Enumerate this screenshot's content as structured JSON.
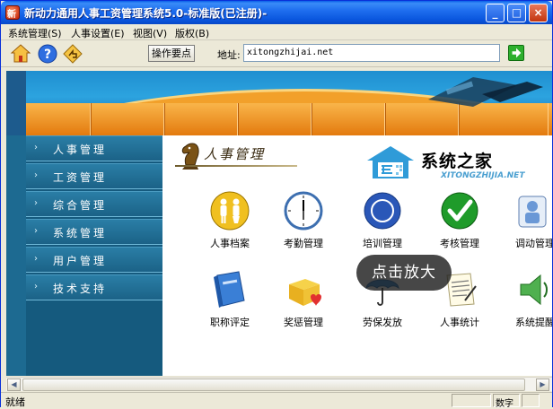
{
  "window": {
    "title": "新动力通用人事工资管理系统5.0-标准版(已注册)-",
    "controls": {
      "minimize": "_",
      "maximize": "□",
      "close": "×"
    }
  },
  "menu": [
    {
      "label": "系统管理(S)"
    },
    {
      "label": "人事设置(E)"
    },
    {
      "label": "视图(V)"
    },
    {
      "label": "版权(B)"
    }
  ],
  "toolbar": {
    "icons": [
      "home-icon",
      "help-icon",
      "back-icon"
    ],
    "guide_button": "操作要点",
    "address_label": "地址:",
    "address_value": "xitongzhijai.net",
    "go_icon": "arrow-right-icon"
  },
  "sidenav": {
    "items": [
      {
        "label": "人事管理"
      },
      {
        "label": "工资管理"
      },
      {
        "label": "综合管理"
      },
      {
        "label": "系统管理"
      },
      {
        "label": "用户管理"
      },
      {
        "label": "技术支持"
      }
    ],
    "arrow": "›"
  },
  "content": {
    "section_title": "人事管理",
    "logo": {
      "name": "系统之家",
      "sub": "XITONGZHIJIA.NET"
    },
    "zoom_tip": "点击放大",
    "tiles": [
      {
        "label": "人事档案",
        "icon": "people-icon"
      },
      {
        "label": "考勤管理",
        "icon": "clock-icon"
      },
      {
        "label": "培训管理",
        "icon": "training-icon"
      },
      {
        "label": "考核管理",
        "icon": "checkmark-icon"
      },
      {
        "label": "调动管理",
        "icon": "transfer-icon"
      },
      {
        "label": "职称评定",
        "icon": "book-icon"
      },
      {
        "label": "奖惩管理",
        "icon": "gift-icon"
      },
      {
        "label": "劳保发放",
        "icon": "umbrella-icon"
      },
      {
        "label": "人事统计",
        "icon": "document-icon"
      },
      {
        "label": "系统提醒",
        "icon": "speaker-icon"
      }
    ]
  },
  "statusbar": {
    "text": "就绪",
    "cells": [
      "",
      "数字",
      ""
    ]
  },
  "colors": {
    "title_bar": "#0a56de",
    "nav_bg": "#155a7e",
    "banner_orange": "#f2a02a",
    "banner_blue": "#2ca3df"
  }
}
